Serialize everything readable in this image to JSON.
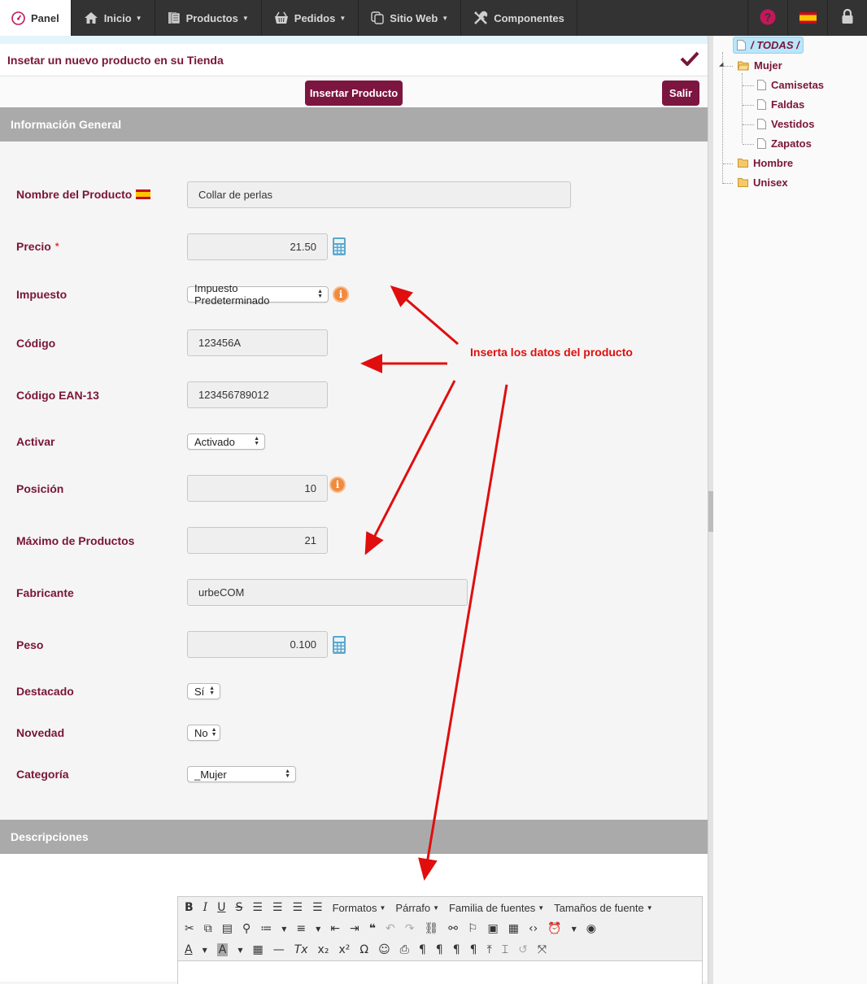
{
  "nav": {
    "panel": "Panel",
    "items": [
      {
        "label": "Inicio",
        "icon": "home-icon"
      },
      {
        "label": "Productos",
        "icon": "products-icon"
      },
      {
        "label": "Pedidos",
        "icon": "basket-icon"
      },
      {
        "label": "Sitio Web",
        "icon": "copy-icon"
      },
      {
        "label": "Componentes",
        "icon": "tools-icon"
      }
    ],
    "right_icons": [
      "help-icon",
      "spain-flag-icon",
      "lock-icon"
    ]
  },
  "page": {
    "title": "Insetar un nuevo producto en su Tienda",
    "insert_button": "Insertar Producto",
    "exit_button": "Salir"
  },
  "sections": {
    "general": "Información General",
    "descriptions": "Descripciones"
  },
  "form": {
    "nombre": {
      "label": "Nombre del Producto",
      "value": "Collar de perlas"
    },
    "precio": {
      "label": "Precio",
      "required": "*",
      "value": "21.50"
    },
    "impuesto": {
      "label": "Impuesto",
      "value": "Impuesto Predeterminado"
    },
    "codigo": {
      "label": "Código",
      "value": "123456A"
    },
    "ean": {
      "label": "Código EAN-13",
      "value": "123456789012"
    },
    "activar": {
      "label": "Activar",
      "value": "Activado"
    },
    "posicion": {
      "label": "Posición",
      "value": "10"
    },
    "maximo": {
      "label": "Máximo de Productos",
      "value": "21"
    },
    "fabricante": {
      "label": "Fabricante",
      "value": "urbeCOM"
    },
    "peso": {
      "label": "Peso",
      "value": "0.100"
    },
    "destacado": {
      "label": "Destacado",
      "value": "Sí"
    },
    "novedad": {
      "label": "Novedad",
      "value": "No"
    },
    "categoria": {
      "label": "Categoría",
      "value": "_Mujer"
    }
  },
  "editor": {
    "formatos": "Formatos",
    "parrafo": "Párrafo",
    "familia": "Familia de fuentes",
    "tamanos": "Tamaños de fuente"
  },
  "annotation": "Inserta los datos del producto",
  "tree": {
    "root": "/ TODAS /",
    "mujer": "Mujer",
    "mujer_children": [
      "Camisetas",
      "Faldas",
      "Vestidos",
      "Zapatos"
    ],
    "hombre": "Hombre",
    "unisex": "Unisex"
  },
  "colors": {
    "brand": "#7a1538",
    "annotation": "#e00e0e",
    "nav_bg": "#333333"
  }
}
